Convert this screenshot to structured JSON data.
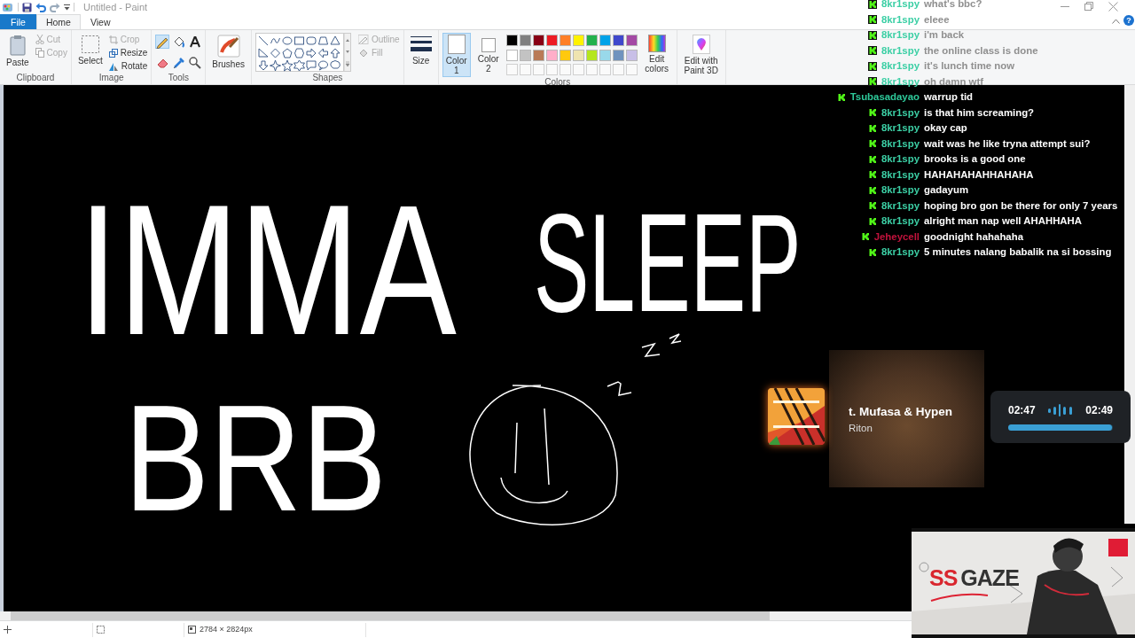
{
  "window": {
    "title": "Untitled - Paint",
    "help": "?"
  },
  "menu_tabs": [
    {
      "label": "File",
      "kind": "file",
      "selected": false
    },
    {
      "label": "Home",
      "kind": "tab",
      "selected": true
    },
    {
      "label": "View",
      "kind": "tab",
      "selected": false
    }
  ],
  "ribbon": {
    "clipboard": {
      "label": "Clipboard",
      "paste": "Paste",
      "cut": {
        "label": "Cut",
        "disabled": true
      },
      "copy": {
        "label": "Copy",
        "disabled": true
      }
    },
    "image": {
      "label": "Image",
      "select": "Select",
      "crop": {
        "label": "Crop",
        "disabled": true
      },
      "resize": "Resize",
      "rotate": "Rotate"
    },
    "tools": {
      "label": "Tools",
      "items": [
        {
          "kind": "pencil",
          "selected": true
        },
        {
          "kind": "fill",
          "selected": false
        },
        {
          "kind": "text",
          "selected": false
        },
        {
          "kind": "eraser",
          "selected": false
        },
        {
          "kind": "picker",
          "selected": false
        },
        {
          "kind": "magnifier",
          "selected": false
        }
      ]
    },
    "brushes": "Brushes",
    "shapes": {
      "label": "Shapes",
      "outline": {
        "label": "Outline",
        "disabled": true
      },
      "fill": {
        "label": "Fill",
        "disabled": true
      }
    },
    "size": "Size",
    "colors": {
      "label": "Colors",
      "color1": {
        "label": "Color 1",
        "selected": true
      },
      "color2": {
        "label": "Color 2",
        "selected": false
      },
      "palette": [
        {
          "color": "#000000"
        },
        {
          "color": "#7f7f7f"
        },
        {
          "color": "#880015"
        },
        {
          "color": "#ed1c24"
        },
        {
          "color": "#ff7f27"
        },
        {
          "color": "#fff200"
        },
        {
          "color": "#22b14c"
        },
        {
          "color": "#00a2e8"
        },
        {
          "color": "#3f48cc"
        },
        {
          "color": "#a349a4"
        },
        {
          "color": "#ffffff"
        },
        {
          "color": "#c3c3c3"
        },
        {
          "color": "#b97a57"
        },
        {
          "color": "#ffaec9"
        },
        {
          "color": "#ffc90e"
        },
        {
          "color": "#efe4b0"
        },
        {
          "color": "#b5e61d"
        },
        {
          "color": "#99d9ea"
        },
        {
          "color": "#7092be"
        },
        {
          "color": "#c8bfe7"
        }
      ],
      "edit_colors": "Edit colors"
    },
    "paint3d": "Edit with Paint 3D"
  },
  "canvas": {
    "words": [
      "IMMA",
      "SLEEP",
      "BRB"
    ]
  },
  "status_bar": {
    "dimensions": "2784 × 2824px"
  },
  "chat": {
    "messages": [
      {
        "user": "8kr1spy",
        "text": "what's bbc?",
        "color": "#3ccfa5",
        "faded": true
      },
      {
        "user": "8kr1spy",
        "text": "eleee",
        "color": "#3ccfa5",
        "faded": true
      },
      {
        "user": "8kr1spy",
        "text": "i'm back",
        "color": "#3ccfa5",
        "faded": true
      },
      {
        "user": "8kr1spy",
        "text": "the online class is done",
        "color": "#3ccfa5",
        "faded": true
      },
      {
        "user": "8kr1spy",
        "text": "it's lunch time now",
        "color": "#3ccfa5",
        "faded": true
      },
      {
        "user": "8kr1spy",
        "text": "oh damn wtf",
        "color": "#3ccfa5",
        "faded": true
      },
      {
        "user": "Tsubasadayao",
        "text": "warrup tid",
        "color": "#2ec99a",
        "faded": false
      },
      {
        "user": "8kr1spy",
        "text": "is that him screaming?",
        "color": "#3ccfa5",
        "faded": false
      },
      {
        "user": "8kr1spy",
        "text": "okay cap",
        "color": "#3ccfa5",
        "faded": false
      },
      {
        "user": "8kr1spy",
        "text": "wait was he like tryna attempt sui?",
        "color": "#3ccfa5",
        "faded": false
      },
      {
        "user": "8kr1spy",
        "text": "brooks is a good one",
        "color": "#3ccfa5",
        "faded": false
      },
      {
        "user": "8kr1spy",
        "text": "HAHAHAHAHHAHAHA",
        "color": "#3ccfa5",
        "faded": false
      },
      {
        "user": "8kr1spy",
        "text": "gadayum",
        "color": "#3ccfa5",
        "faded": false
      },
      {
        "user": "8kr1spy",
        "text": "hoping bro gon be there for only 7 years",
        "color": "#3ccfa5",
        "faded": false
      },
      {
        "user": "8kr1spy",
        "text": "alright man nap well AHAHHAHA",
        "color": "#3ccfa5",
        "faded": false
      },
      {
        "user": "Jeheycell",
        "text": "goodnight hahahaha",
        "color": "#c2123c",
        "faded": false
      },
      {
        "user": "8kr1spy",
        "text": "5 minutes nalang babalik na si bossing",
        "color": "#3ccfa5",
        "faded": false
      }
    ]
  },
  "music": {
    "title": "t. Mufasa & Hypen",
    "artist": "Riton",
    "elapsed": "02:47",
    "total": "02:49",
    "level": 0.99
  },
  "banner": {
    "name_a": "SS",
    "name_b": "GAZE"
  }
}
